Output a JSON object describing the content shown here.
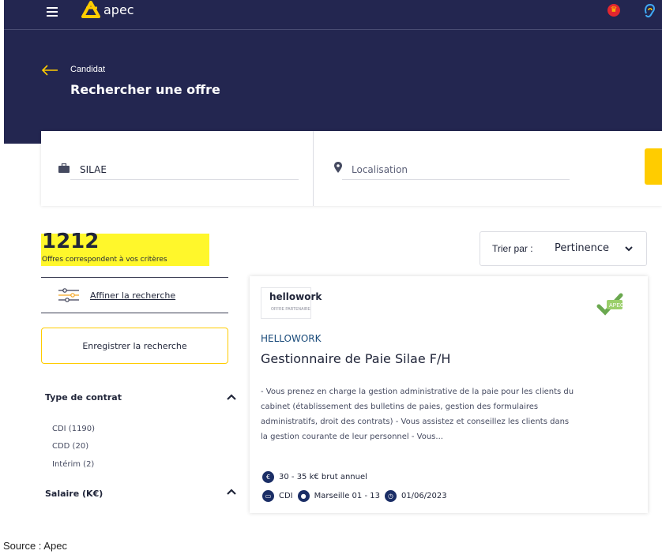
{
  "header": {
    "logo_text": "apec",
    "icons": [
      "menu-icon",
      "apec-logo-icon",
      "crown-icon",
      "ear-icon"
    ],
    "navy": "#232650"
  },
  "hero": {
    "breadcrumb": "Candidat",
    "title": "Rechercher une offre"
  },
  "search": {
    "keyword_value": "SILAE",
    "location_placeholder": "Localisation",
    "accent": "#ffcc00"
  },
  "results": {
    "count": "1212",
    "count_label": "Offres correspondent à vos critères",
    "highlight": "#fff72b"
  },
  "sort": {
    "label": "Trier par :",
    "value": "Pertinence"
  },
  "sidebar": {
    "refine_label": "Affiner la recherche",
    "save_search_label": "Enregistrer la recherche",
    "filters": [
      {
        "heading": "Type de contrat",
        "options": [
          "CDI (1190)",
          "CDD (20)",
          "Intérim (2)"
        ]
      },
      {
        "heading": "Salaire (K€)",
        "options": []
      }
    ]
  },
  "offer": {
    "logo_line1": "hellowork",
    "logo_line2": "OFFRE PARTENAIRE",
    "company": "HELLOWORK",
    "title": "Gestionnaire de Paie Silae F/H",
    "description": "- Vous prenez en charge la gestion administrative de la paie pour les clients du cabinet (établissement des bulletins de paies, gestion des formulaires administratifs, droit des contrats) - Vous assistez et conseillez les clients dans la gestion courante de leur personnel - Vous...",
    "salary": "30 - 35 k€ brut annuel",
    "contract": "CDI",
    "location": "Marseille 01 - 13",
    "date": "01/06/2023"
  },
  "source_note": "Source : Apec"
}
